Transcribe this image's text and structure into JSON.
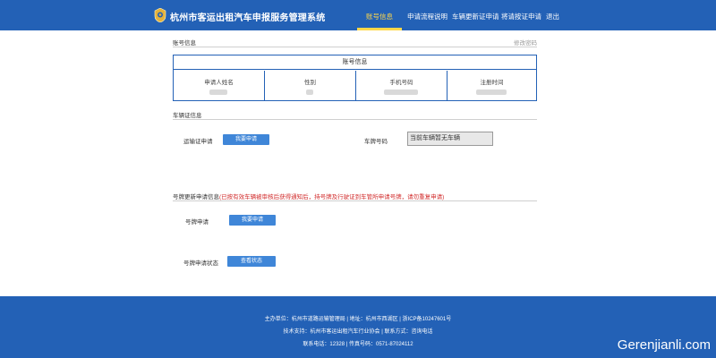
{
  "header": {
    "site_title": "杭州市客运出租汽车申报服务管理系统",
    "nav": [
      {
        "label": "账号信息",
        "active": true
      },
      {
        "label": "申请流程说明",
        "active": false
      },
      {
        "label": "车辆更新证申请",
        "active": false
      },
      {
        "label": "将请按证申请",
        "active": false
      },
      {
        "label": "退出",
        "active": false
      }
    ]
  },
  "account_section": {
    "title": "账号信息",
    "right_link": "修改密码",
    "table_caption": "账号信息",
    "columns": [
      {
        "label": "申请人姓名"
      },
      {
        "label": "性别"
      },
      {
        "label": "手机号码"
      },
      {
        "label": "注册时间"
      }
    ]
  },
  "vehicle_section": {
    "title": "车辆证信息",
    "apply_label": "运输证申请",
    "apply_button": "我要申请",
    "plate_label": "车牌号码",
    "plate_value": "当前车辆暂无车辆"
  },
  "plate_section": {
    "title_prefix": "号牌更新申请信息",
    "title_note": "(已按有效车辆被审核后获得通知后，持号牌及行驶证到车管所申请号牌，请勿重复申请)",
    "apply_label": "号牌申请",
    "apply_button": "我要申请",
    "status_label": "号牌申请状态",
    "status_button": "查看状态"
  },
  "footer": {
    "line1": "主办单位：杭州市道路运输管理局 | 地址：杭州市西湖区 | 浙ICP备10247601号",
    "line2": "技术支持：杭州市客运出租汽车行业协会 | 联系方式：咨询电话",
    "line3": "联系电话：12328 | 传真号码：0571-87024112"
  },
  "watermark": "Gerenjianli.com",
  "colors": {
    "primary": "#2361b6",
    "button": "#3f86d8",
    "nav_active": "#ffd84a",
    "warning": "#d12b2b"
  },
  "icons": {
    "logo": "emblem-icon"
  }
}
